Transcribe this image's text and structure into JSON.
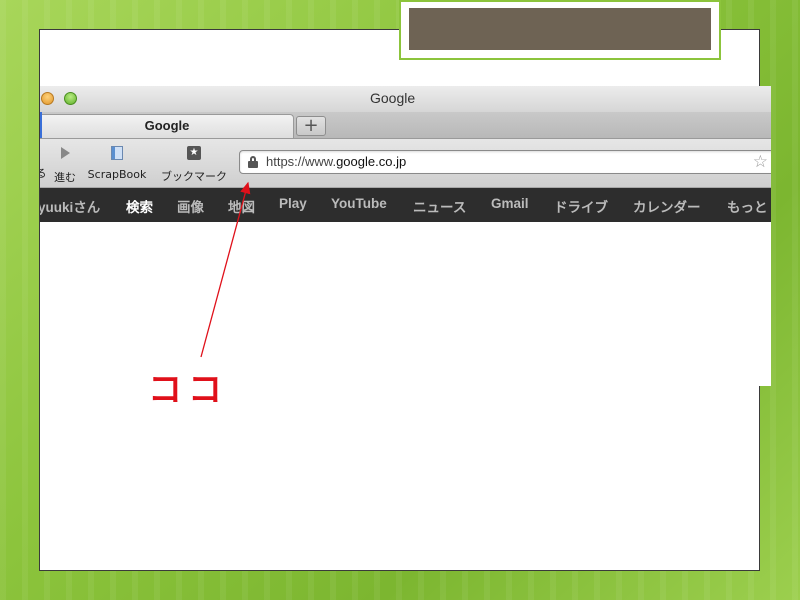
{
  "browser": {
    "window_title": "Google",
    "tab_title": "Google",
    "new_tab_label": "+",
    "toolbar": {
      "back_label": "る",
      "forward_label": "進む",
      "scrapbook_label": "ScrapBook",
      "bookmark_label": "ブックマーク"
    },
    "address": {
      "prefix": "https://www.",
      "domain": "google.co.jp"
    }
  },
  "google_bar": {
    "items": [
      {
        "label": "yuukiさん",
        "active": false
      },
      {
        "label": "検索",
        "active": true
      },
      {
        "label": "画像",
        "active": false
      },
      {
        "label": "地図",
        "active": false
      },
      {
        "label": "Play",
        "active": false
      },
      {
        "label": "YouTube",
        "active": false
      },
      {
        "label": "ニュース",
        "active": false
      },
      {
        "label": "Gmail",
        "active": false
      },
      {
        "label": "ドライブ",
        "active": false
      },
      {
        "label": "カレンダー",
        "active": false
      },
      {
        "label": "もっと",
        "active": false
      }
    ]
  },
  "annotation": {
    "text": "ココ",
    "color": "#e0101a"
  },
  "icons": {
    "forward": "play-triangle-icon",
    "scrapbook": "book-icon",
    "bookmark": "bookmark-star-icon",
    "secure": "lock-icon",
    "favorite": "star-icon"
  }
}
